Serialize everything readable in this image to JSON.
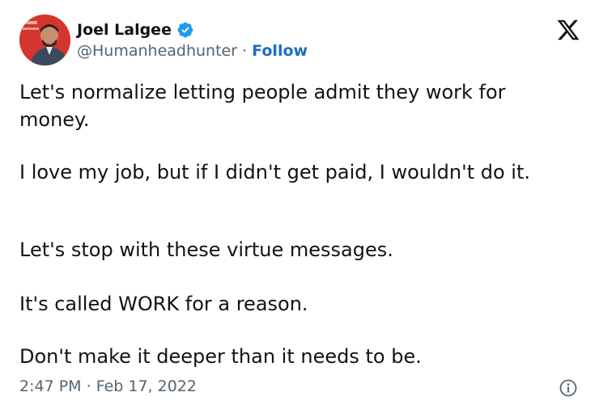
{
  "author": {
    "display_name": "Joel Lalgee",
    "handle": "@Humanheadhunter",
    "separator": " · ",
    "follow_label": "Follow",
    "avatar_icon": "profile-photo",
    "verified_icon": "verified-badge-icon"
  },
  "tweet": {
    "paragraphs": [
      "Let's normalize letting people admit they work for money.",
      "I love my job, but if I didn't get paid, I wouldn't do it.",
      "Let's stop with these virtue messages.",
      "It's called WORK for a reason.",
      "Don't make it deeper than it needs to be."
    ]
  },
  "meta": {
    "time": "2:47 PM",
    "separator": " · ",
    "date": "Feb 17, 2022"
  },
  "icons": {
    "brand": "x-logo-icon",
    "info": "info-icon"
  },
  "colors": {
    "text": "#0f1419",
    "muted": "#536471",
    "follow": "#1d6fbf",
    "verified": "#1d9bf0"
  }
}
